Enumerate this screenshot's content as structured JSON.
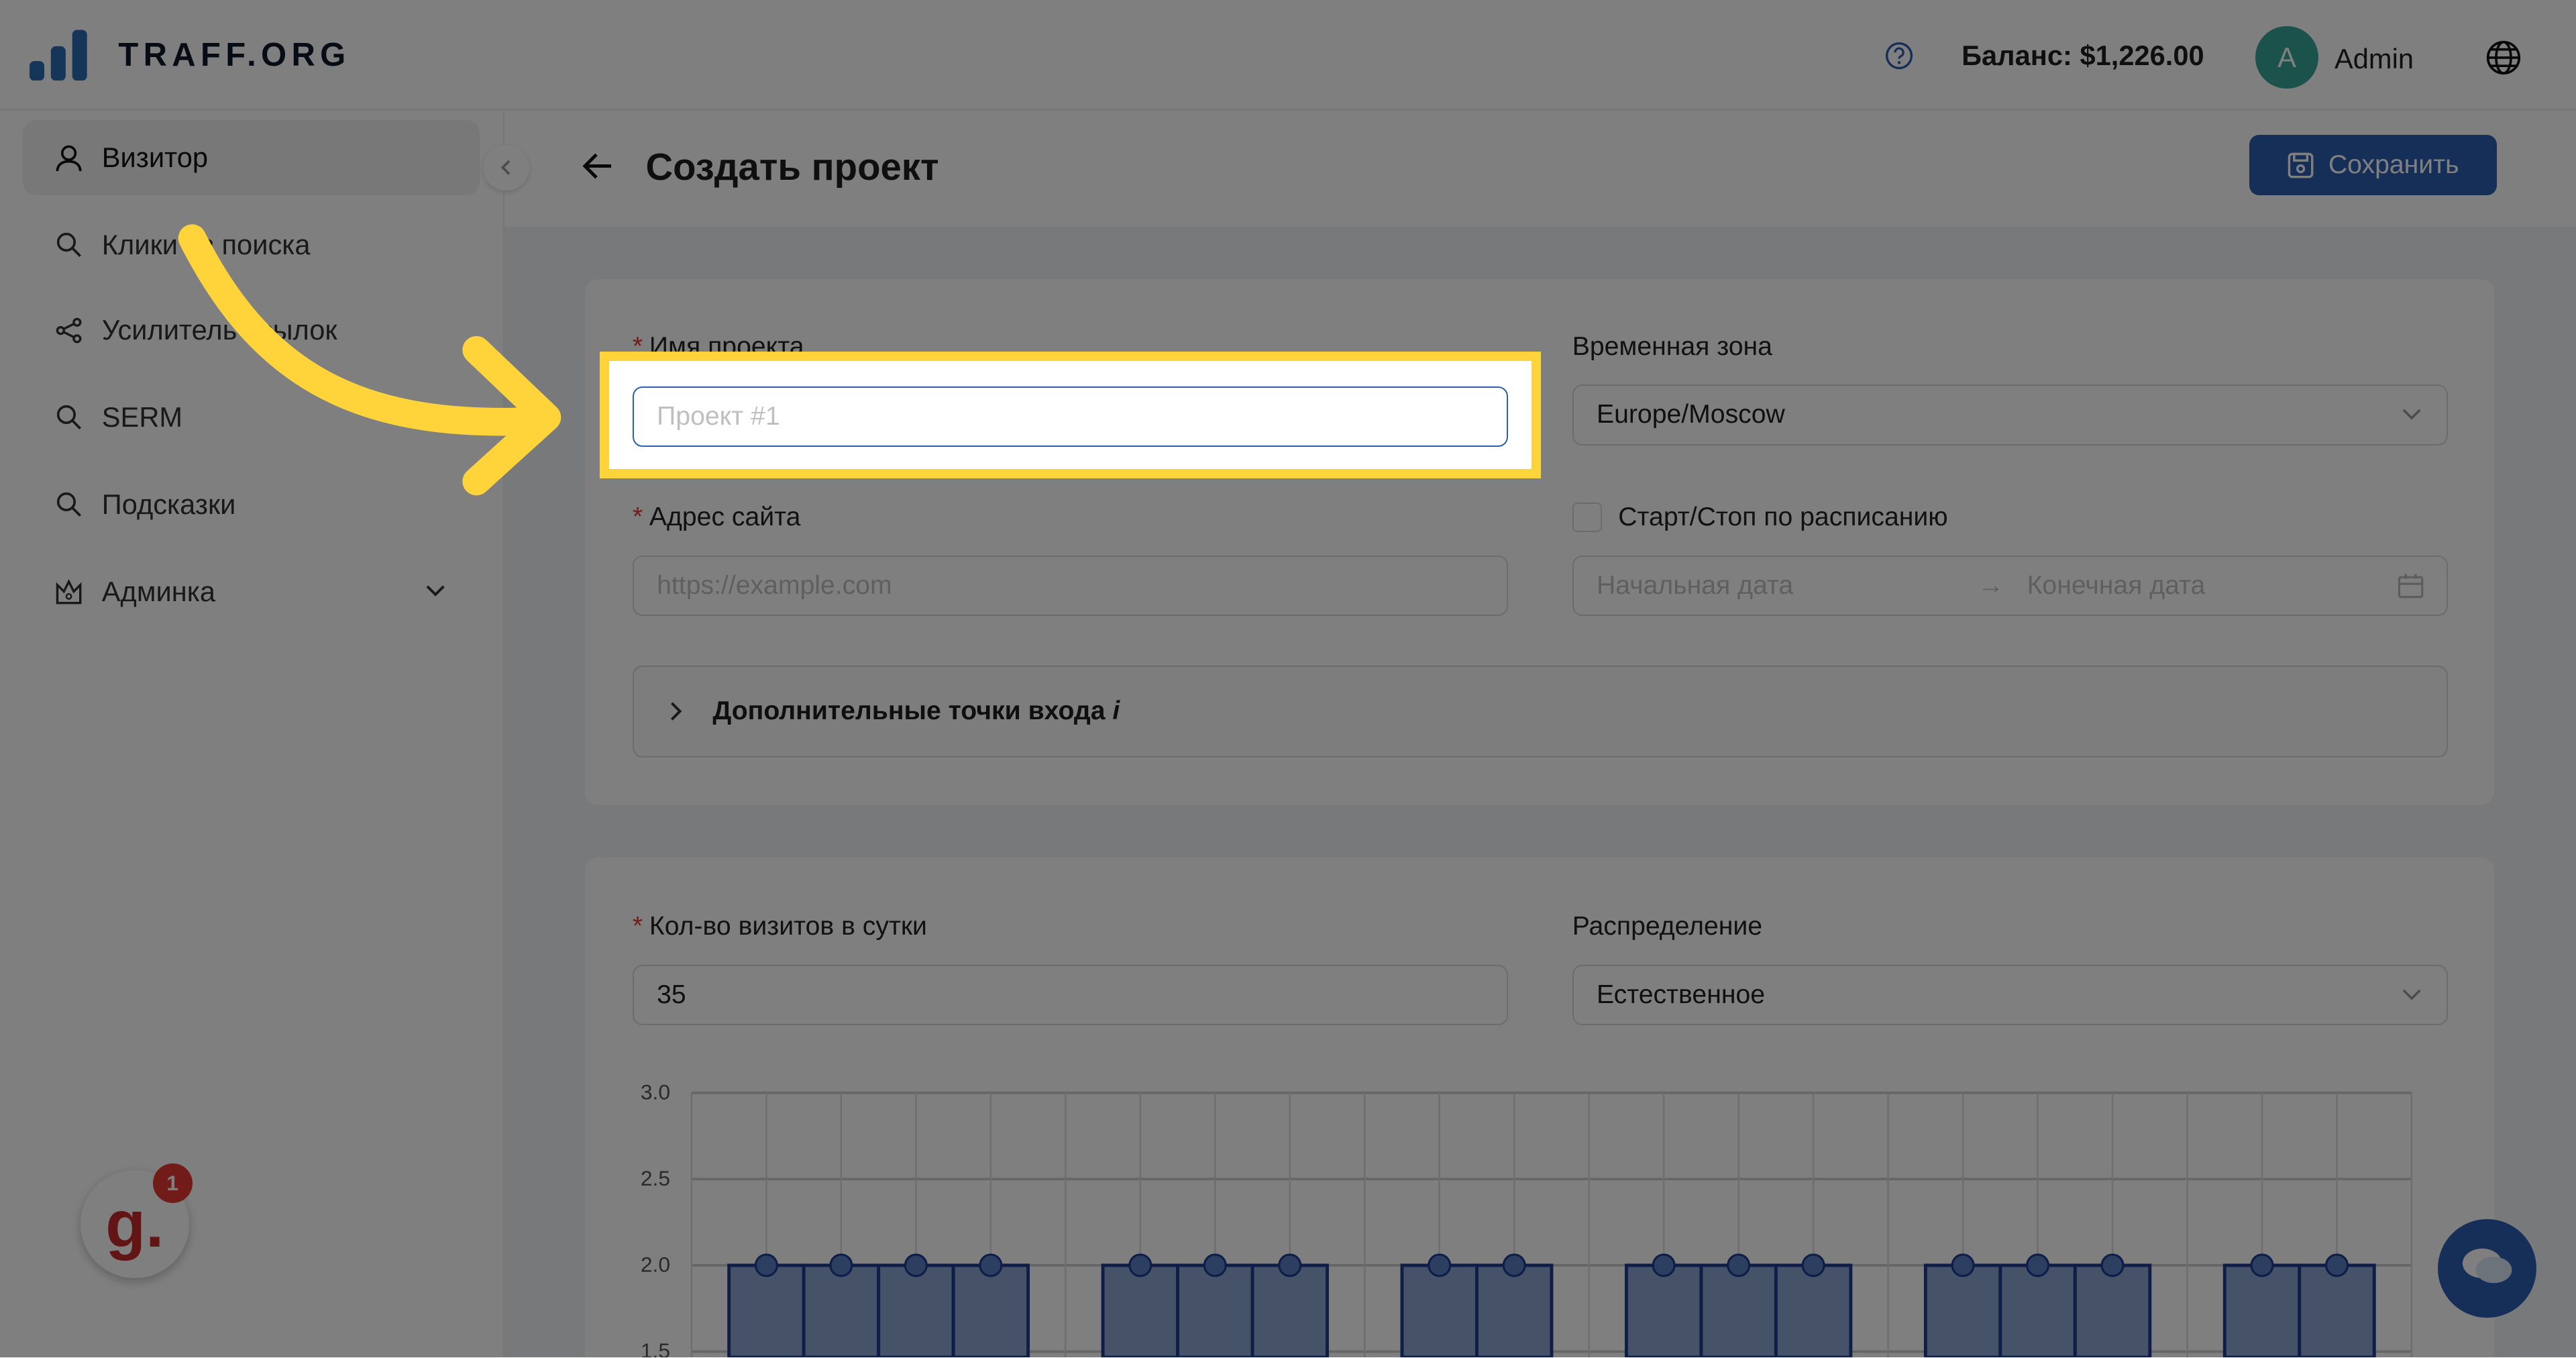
{
  "header": {
    "brand": "TRAFF.ORG",
    "balance": "Баланс: $1,226.00",
    "avatar_letter": "A",
    "user": "Admin"
  },
  "sidebar": {
    "items": [
      {
        "label": "Визитор",
        "icon": "user-icon",
        "active": true
      },
      {
        "label": "Клики из поиска",
        "icon": "search-icon"
      },
      {
        "label": "Усилитель ссылок",
        "icon": "share-icon"
      },
      {
        "label": "SERM",
        "icon": "search-icon"
      },
      {
        "label": "Подсказки",
        "icon": "search-icon"
      },
      {
        "label": "Админка",
        "icon": "crown-icon"
      }
    ]
  },
  "page": {
    "title": "Создать проект",
    "save_label": "Сохранить"
  },
  "form": {
    "project_name_label": "Имя проекта",
    "project_name_placeholder": "Проект #1",
    "timezone_label": "Временная зона",
    "timezone_value": "Europe/Moscow",
    "site_label": "Адрес сайта",
    "site_placeholder": "https://example.com",
    "schedule_label": "Старт/Стоп по расписанию",
    "start_placeholder": "Начальная дата",
    "end_placeholder": "Конечная дата",
    "extra_entry_label": "Дополнительные точки входа",
    "extra_entry_info": "i",
    "visits_label": "Кол-во визитов в сутки",
    "visits_value": "35",
    "distribution_label": "Распределение",
    "distribution_value": "Естественное"
  },
  "widget": {
    "badge": "1",
    "logo_letter": "g."
  },
  "colors": {
    "accent": "#2c5fb0",
    "highlight": "#ffd43b",
    "bar": "#1f3a93"
  },
  "chart_data": {
    "type": "bar",
    "x_range": [
      0,
      23
    ],
    "ylim": [
      1.5,
      3.0
    ],
    "yticks": [
      "3.0",
      "2.5",
      "2.0",
      "1.5"
    ],
    "points": [
      [
        1,
        2
      ],
      [
        2,
        2
      ],
      [
        3,
        2
      ],
      [
        4,
        2
      ],
      [
        6,
        2
      ],
      [
        7,
        2
      ],
      [
        8,
        2
      ],
      [
        10,
        2
      ],
      [
        11,
        2
      ],
      [
        13,
        2
      ],
      [
        14,
        2
      ],
      [
        15,
        2
      ],
      [
        17,
        2
      ],
      [
        18,
        2
      ],
      [
        19,
        2
      ],
      [
        21,
        2
      ],
      [
        22,
        2
      ]
    ]
  }
}
